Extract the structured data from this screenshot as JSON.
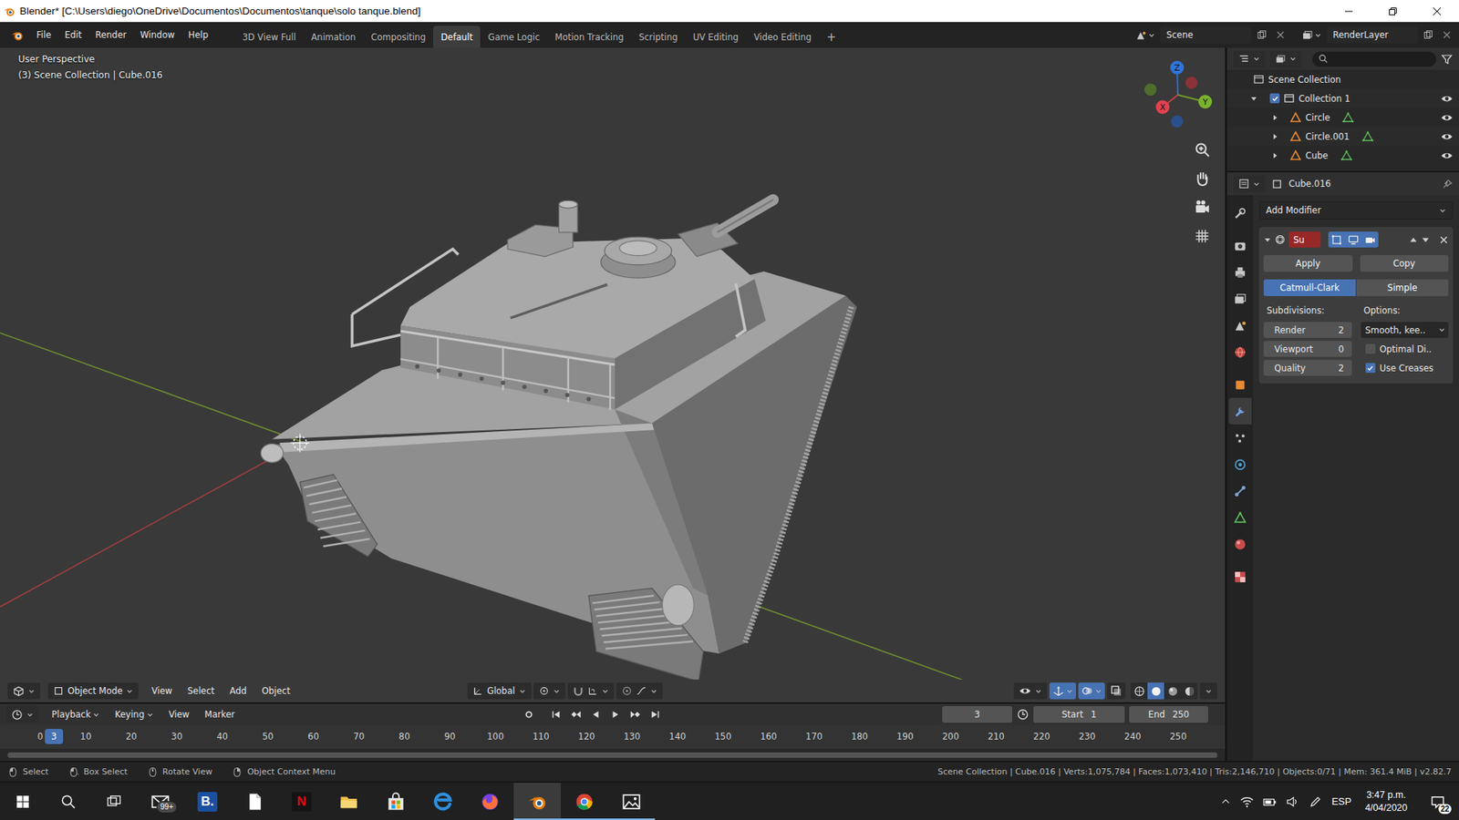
{
  "window": {
    "title": "Blender* [C:\\Users\\diego\\OneDrive\\Documentos\\Documentos\\tanque\\solo tanque.blend]"
  },
  "menu": [
    "File",
    "Edit",
    "Render",
    "Window",
    "Help"
  ],
  "workspaces": [
    {
      "label": "3D View Full",
      "selected": false
    },
    {
      "label": "Animation",
      "selected": false
    },
    {
      "label": "Compositing",
      "selected": false
    },
    {
      "label": "Default",
      "selected": true
    },
    {
      "label": "Game Logic",
      "selected": false
    },
    {
      "label": "Motion Tracking",
      "selected": false
    },
    {
      "label": "Scripting",
      "selected": false
    },
    {
      "label": "UV Editing",
      "selected": false
    },
    {
      "label": "Video Editing",
      "selected": false
    }
  ],
  "add_workspace": "+",
  "scene": "Scene",
  "view_layer": "RenderLayer",
  "viewport": {
    "perspective": "User Perspective",
    "context": "(3) Scene Collection | Cube.016",
    "axes": {
      "x": "X",
      "y": "Y",
      "z": "Z"
    },
    "header": {
      "mode": "Object Mode",
      "menus": [
        "View",
        "Select",
        "Add",
        "Object"
      ],
      "orientation": "Global",
      "toggles": [
        {
          "kind": "gizmos",
          "on": true
        },
        {
          "kind": "overlays",
          "on": true
        },
        {
          "kind": "xray",
          "on": false
        }
      ],
      "shading": [
        {
          "kind": "wireframe",
          "selected": false
        },
        {
          "kind": "solid",
          "selected": true
        },
        {
          "kind": "material",
          "selected": false
        },
        {
          "kind": "rendered",
          "selected": false
        }
      ]
    }
  },
  "outliner": {
    "root": "Scene Collection",
    "collection": {
      "name": "Collection 1",
      "expanded": true,
      "checked": true,
      "visible": true
    },
    "objects": [
      {
        "name": "Circle",
        "expanded": false,
        "visible": true
      },
      {
        "name": "Circle.001",
        "expanded": false,
        "visible": true
      },
      {
        "name": "Cube",
        "expanded": false,
        "visible": true
      }
    ]
  },
  "properties": {
    "object": "Cube.016",
    "tabs": [
      {
        "kind": "tool",
        "selected": false
      },
      {
        "kind": "render",
        "selected": false
      },
      {
        "kind": "output",
        "selected": false
      },
      {
        "kind": "view_layer",
        "selected": false
      },
      {
        "kind": "scene",
        "selected": false
      },
      {
        "kind": "world",
        "selected": false
      },
      {
        "kind": "object",
        "selected": false
      },
      {
        "kind": "modifier",
        "selected": true
      },
      {
        "kind": "particles",
        "selected": false
      },
      {
        "kind": "physics",
        "selected": false
      },
      {
        "kind": "constraints",
        "selected": false
      },
      {
        "kind": "data",
        "selected": false
      },
      {
        "kind": "material",
        "selected": false
      },
      {
        "kind": "texture",
        "selected": false
      }
    ],
    "add_modifier": "Add Modifier",
    "modifier": {
      "name": "Su",
      "expanded": true,
      "toggles": [
        {
          "kind": "editmode",
          "on": true
        },
        {
          "kind": "viewport",
          "on": true
        },
        {
          "kind": "render",
          "on": true
        }
      ],
      "actions": [
        "Apply",
        "Copy"
      ],
      "types": [
        {
          "label": "Catmull-Clark",
          "selected": true
        },
        {
          "label": "Simple",
          "selected": false
        }
      ],
      "subdivisions_label": "Subdivisions:",
      "options_label": "Options:",
      "fields": [
        {
          "label": "Render",
          "value": "2"
        },
        {
          "label": "Viewport",
          "value": "0"
        },
        {
          "label": "Quality",
          "value": "2"
        }
      ],
      "uv_smooth": "Smooth, kee..",
      "checkboxes": [
        {
          "label": "Optimal Di..",
          "checked": false
        },
        {
          "label": "Use Creases",
          "checked": true
        }
      ]
    }
  },
  "timeline": {
    "menus": [
      {
        "label": "Playback",
        "dropdown": true
      },
      {
        "label": "Keying",
        "dropdown": true
      },
      {
        "label": "View",
        "dropdown": false
      },
      {
        "label": "Marker",
        "dropdown": false
      }
    ],
    "current_frame": "3",
    "start_label": "Start",
    "start": "1",
    "end_label": "End",
    "end": "250",
    "ruler": [
      "0",
      "10",
      "20",
      "30",
      "40",
      "50",
      "60",
      "70",
      "80",
      "90",
      "100",
      "110",
      "120",
      "130",
      "140",
      "150",
      "160",
      "170",
      "180",
      "190",
      "200",
      "210",
      "220",
      "230",
      "240",
      "250"
    ]
  },
  "status_bar": {
    "hints": [
      "Select",
      "Box Select",
      "Rotate View",
      "Object Context Menu"
    ],
    "stats": "Scene Collection | Cube.016 | Verts:1,075,784 | Faces:1,073,410 | Tris:2,146,710 | Objects:0/71 | Mem: 361.4 MiB | v2.82.7"
  },
  "taskbar": {
    "apps": [
      {
        "kind": "mail",
        "badge": "99+",
        "running": false,
        "active": false
      },
      {
        "kind": "booking",
        "label": "B.",
        "running": false,
        "active": false
      },
      {
        "kind": "notepad",
        "running": false,
        "active": false
      },
      {
        "kind": "netflix",
        "label": "N",
        "running": false,
        "active": false
      },
      {
        "kind": "explorer",
        "running": false,
        "active": false
      },
      {
        "kind": "store",
        "running": false,
        "active": false
      },
      {
        "kind": "edge",
        "running": false,
        "active": false
      },
      {
        "kind": "firefox",
        "running": false,
        "active": false
      },
      {
        "kind": "blender",
        "running": true,
        "active": true
      },
      {
        "kind": "chrome",
        "running": true,
        "active": false
      },
      {
        "kind": "photos",
        "running": true,
        "active": false
      }
    ],
    "language": "ESP",
    "time": "3:47 p.m.",
    "date": "4/04/2020",
    "notifications": "22"
  }
}
